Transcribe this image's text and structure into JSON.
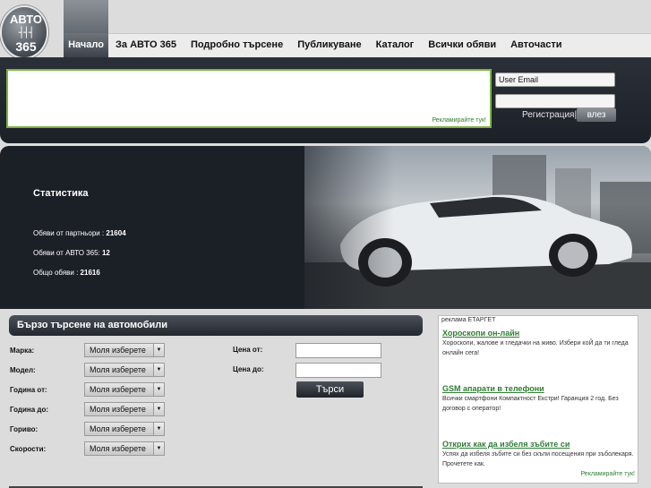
{
  "logo": {
    "line1": "АВТО",
    "line2": "┤┤┤",
    "line3": "365"
  },
  "nav": {
    "items": [
      {
        "label": "Начало",
        "active": true
      },
      {
        "label": "За АВТО 365"
      },
      {
        "label": "Подробно търсене"
      },
      {
        "label": "Публикуване"
      },
      {
        "label": "Каталог"
      },
      {
        "label": "Всички обяви"
      },
      {
        "label": "Автoчасти"
      }
    ]
  },
  "header": {
    "ad_link": "Рекламирайте тук!",
    "email_value": "User Email",
    "register_label": "Регистрация|",
    "login_label": "влез"
  },
  "stats": {
    "title": "Статистика",
    "partners": "Обяви от партньори : ",
    "partners_value": "21604",
    "own": "Обяви от АВТО 365: ",
    "own_value": "12",
    "total": "Общо обяви : ",
    "total_value": "21616"
  },
  "search": {
    "title": "Бързо търсене на автомобили",
    "fields": [
      {
        "label": "Марка:",
        "value": "Моля изберете"
      },
      {
        "label": "Модел:",
        "value": "Моля изберете"
      },
      {
        "label": "Година от:",
        "value": "Моля изберете"
      },
      {
        "label": "Година до:",
        "value": "Моля изберете"
      },
      {
        "label": "Гориво:",
        "value": "Моля изберете"
      },
      {
        "label": "Скорости:",
        "value": "Моля изберете"
      }
    ],
    "price_from": "Цена от:",
    "price_to": "Цена до:",
    "search_button": "Търси"
  },
  "ads": {
    "header": "реклама ЕТАРГЕТ",
    "items": [
      {
        "title": "Хороскопи он-лайн",
        "text": "Хороскопи, жалове и гледачки на живо. Избери коЙ да ти гледа онлайн сега!"
      },
      {
        "title": "GSM апарати в телефони",
        "text": "Всички смартфони Компактност Екстри! Гаранция 2 год. Без договор с оператор!"
      },
      {
        "title": "Открих как да избеля зъбите си",
        "text": "Успях да избеля зъбите си без скъпи посещения при зъболекаря. Прочетете как."
      }
    ],
    "footer": "Рекламирайте тук!"
  }
}
